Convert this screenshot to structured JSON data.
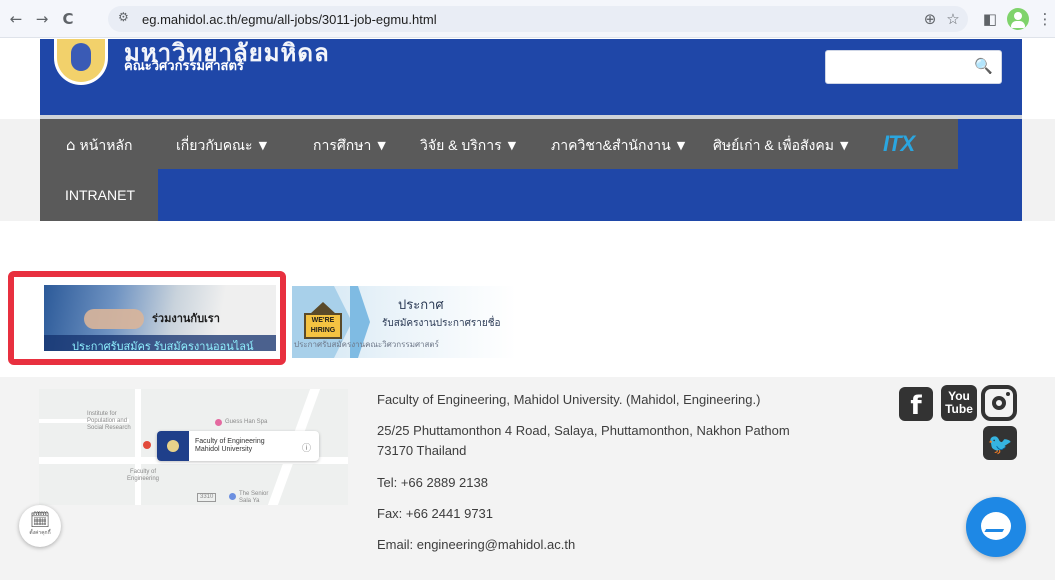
{
  "browser": {
    "url": "eg.mahidol.ac.th/egmu/all-jobs/3011-job-egmu.html",
    "back_icon": "←",
    "forward_icon": "→",
    "reload_icon": "C",
    "site_settings_icon": "⚙",
    "zoom_icon": "⊕",
    "star_icon": "☆",
    "sidepanel_icon": "◧",
    "menu_icon": "⋮"
  },
  "header": {
    "logo_title": "มหาวิทยาลัยมหิดล",
    "logo_subtitle": "คณะวิศวกรรมศาสตร์",
    "search_placeholder": "",
    "search_icon": "🔍"
  },
  "nav": {
    "home_icon": "⌂",
    "items": [
      {
        "label": "หน้าหลัก"
      },
      {
        "label": "เกี่ยวกับคณะ"
      },
      {
        "label": "การศึกษา"
      },
      {
        "label": "วิจัย & บริการ"
      },
      {
        "label": "ภาควิชา&สำนักงาน"
      },
      {
        "label": "ศิษย์เก่า & เพื่อสังคม"
      }
    ],
    "caret": "▼",
    "itx_label": "ITX",
    "intranet": "INTRANET"
  },
  "banners": {
    "join_title": "ร่วมงานกับเรา",
    "join_subtitle": "ประกาศรับสมัคร รับสมัครงานออนไลน์",
    "hiring_sign": "WE'RE HIRING",
    "notice_title": "ประกาศ",
    "notice_subtitle": "รับสมัครงานประกาศรายชื่อ",
    "notice_footer": "ประกาศรับสมัครงานคณะวิศวกรรมศาสตร์"
  },
  "map": {
    "card_title": "Faculty of Engineering",
    "card_subtitle": "Mahidol University",
    "info_icon": "ⓘ",
    "labels": [
      {
        "text": "Institute for Population and Social Research"
      },
      {
        "text": "Guess Han Spa"
      },
      {
        "text": "Faculty of Engineering"
      },
      {
        "text": "The Senior Sala Ya"
      },
      {
        "text": "3310"
      }
    ]
  },
  "footer": {
    "org": "Faculty of Engineering, Mahidol University. (Mahidol, Engineering.)",
    "address_line1": "25/25 Phuttamonthon 4 Road, Salaya, Phuttamonthon, Nakhon Pathom",
    "address_line2": "73170 Thailand",
    "tel": "Tel: +66 2889 2138",
    "fax": "Fax: +66 2441 9731",
    "email": "Email: engineering@mahidol.ac.th"
  },
  "social": {
    "facebook": "f",
    "youtube_top": "You",
    "youtube_bottom": "Tube",
    "twitter": "🐦"
  },
  "widgets": {
    "cookie_icon": "🗓",
    "cookie_label": "ตั้งค่าคุกกี้"
  }
}
